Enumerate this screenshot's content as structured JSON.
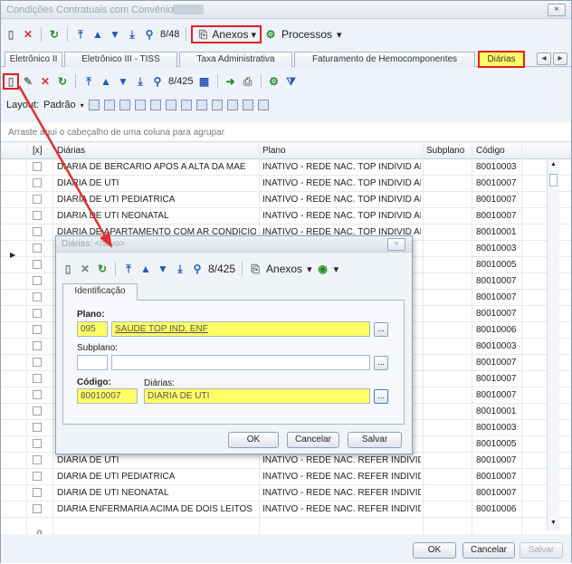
{
  "window": {
    "title": "Condições Contratuais com Convênio:",
    "close": "×"
  },
  "toolbar": {
    "counter": "8/48",
    "anexos": "Anexos",
    "processos": "Processos"
  },
  "tabs": [
    "Eletrônico II",
    "Eletrônico III - TISS",
    "Taxa Administrativa",
    "Faturamento de Hemocomponentes",
    "Diárias"
  ],
  "subtoolbar": {
    "counter": "8/425"
  },
  "layoutbar": {
    "layout": "Layout:",
    "padrao": "Padrão"
  },
  "grid": {
    "group_hint": "Arraste aqui o cabeçalho de uma coluna para agrupar",
    "columns": [
      "[x]",
      "Diárias",
      "Plano",
      "Subplano",
      "Código"
    ],
    "rows": [
      [
        "DIARIA DE BERCARIO APOS A ALTA DA MAE",
        "INATIVO - REDE NAC. TOP INDIVID APTO",
        "80010003"
      ],
      [
        "DIARIA DE UTI",
        "INATIVO - REDE NAC. TOP INDIVID APTO",
        "80010007"
      ],
      [
        "DIARIA DE UTI PEDIATRICA",
        "INATIVO - REDE NAC. TOP INDIVID APTO",
        "80010007"
      ],
      [
        "DIARIA DE UTI NEONATAL",
        "INATIVO - REDE NAC. TOP INDIVID APTO",
        "80010007"
      ],
      [
        "DIARIA DE APARTAMENTO COM AR CONDICIONADO",
        "INATIVO - REDE NAC. TOP INDIVID APTO",
        "80010001"
      ],
      [
        "",
        "",
        "80010003"
      ],
      [
        "",
        "",
        "80010005"
      ],
      [
        "",
        "",
        "80010007"
      ],
      [
        "",
        "",
        "80010007"
      ],
      [
        "",
        "",
        "80010007"
      ],
      [
        "",
        "",
        "80010006"
      ],
      [
        "",
        "",
        "80010003"
      ],
      [
        "",
        "",
        "80010007"
      ],
      [
        "",
        "",
        "80010007"
      ],
      [
        "",
        "",
        "80010007"
      ],
      [
        "",
        "",
        "80010001"
      ],
      [
        "",
        "",
        "80010003"
      ],
      [
        "",
        "",
        "80010005"
      ],
      [
        "DIARIA DE UTI",
        "INATIVO - REDE NAC. REFER INDIVID E...",
        "80010007"
      ],
      [
        "DIARIA DE UTI PEDIATRICA",
        "INATIVO - REDE NAC. REFER INDIVID E...",
        "80010007"
      ],
      [
        "DIARIA DE UTI NEONATAL",
        "INATIVO - REDE NAC. REFER INDIVID E...",
        "80010007"
      ],
      [
        "DIARIA ENFERMARIA ACIMA DE DOIS LEITOS",
        "INATIVO - REDE NAC. REFER INDIVID E...",
        "80010006"
      ]
    ],
    "footer_count": "0"
  },
  "footer": {
    "ok": "OK",
    "cancel": "Cancelar",
    "save": "Salvar"
  },
  "dialog": {
    "title": "Diárias: <novo>",
    "counter": "8/425",
    "anexos": "Anexos",
    "tab": "Identificação",
    "plano_label": "Plano:",
    "plano_code": "095",
    "plano_name": "SAUDE TOP IND. ENF",
    "subplano_label": "Subplano:",
    "codigo_label": "Código:",
    "diarias_label": "Diárias:",
    "codigo_value": "80010007",
    "diarias_value": "DIARIA DE UTI",
    "lookup": "...",
    "ok": "OK",
    "cancel": "Cancelar",
    "save": "Salvar"
  }
}
